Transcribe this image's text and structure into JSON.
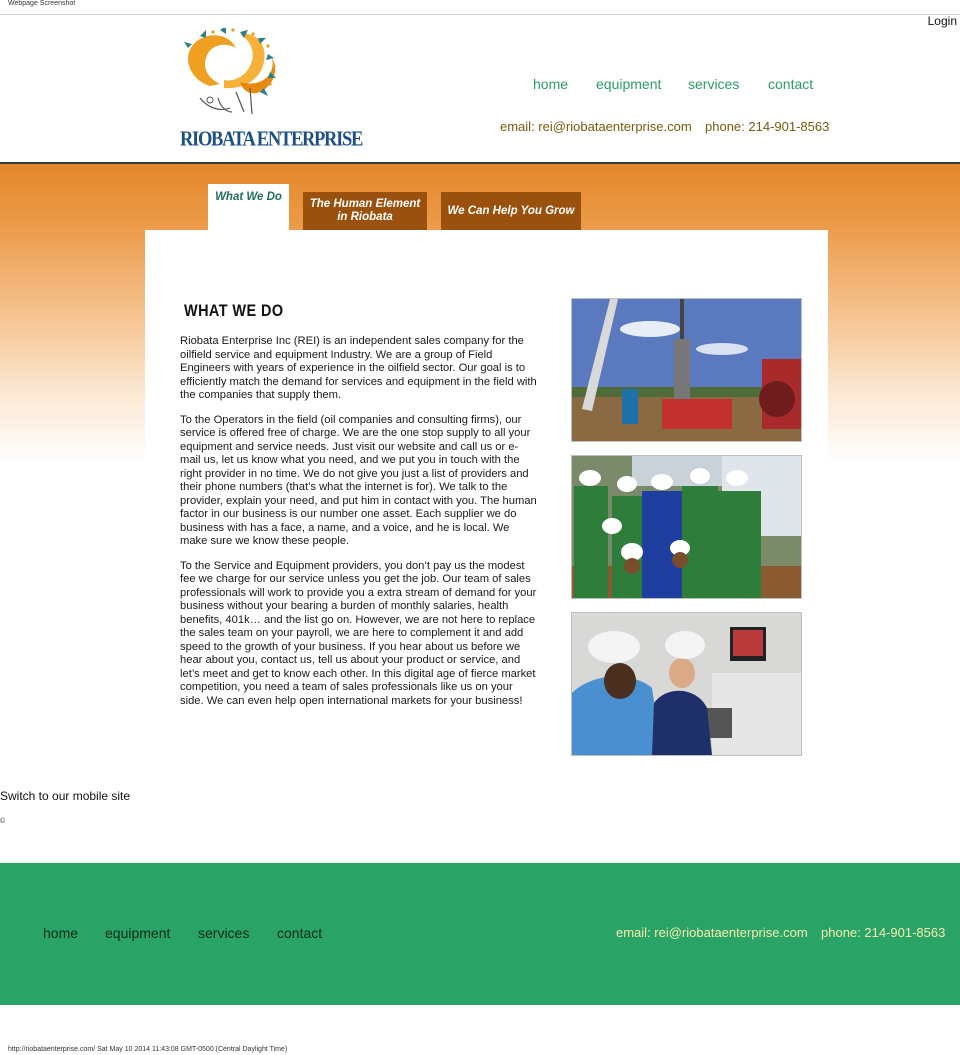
{
  "browser": {
    "caption": "Webpage Screenshot",
    "footer_caption": "http://riobataenterprise.com/ Sat May 10 2014 11:43:08 GMT-0500 (Central Daylight Time)"
  },
  "header": {
    "login": "Login",
    "logo_text": "RIOBATA ENTERPRISE",
    "nav": [
      "home",
      "equipment",
      "services",
      "contact"
    ],
    "email": "email: rei@riobataenterprise.com",
    "phone": "phone: 214-901-8563"
  },
  "tabs": [
    {
      "label": "What We Do",
      "active": true
    },
    {
      "label": "The Human Element in Riobata",
      "active": false
    },
    {
      "label": "We Can Help You Grow",
      "active": false
    }
  ],
  "main": {
    "heading": "WHAT WE DO",
    "paragraphs": [
      "Riobata Enterprise Inc (REI) is an independent sales company for the oilfield service and equipment Industry. We are a group of Field Engineers with years of experience in the oilfield sector. Our goal is to efficiently match the demand for services and equipment in the field with the companies that supply them.",
      "To the Operators in the field (oil companies and consulting firms), our service is offered free of charge. We are the one stop supply to all your equipment and service needs. Just visit our website and call us or e-mail us, let us know what you need, and we put you in touch with the right provider in no time. We do not give you just a list of providers and their phone numbers (that’s what the internet is for). We talk to the provider, explain your need, and put him in contact with you. The human factor in our business is our number one asset. Each supplier we do business with has a face, a name, and a voice, and he is local. We make sure we know these people.",
      "To the Service and Equipment providers, you don’t pay us the modest fee we charge for our service unless you get the job. Our team of sales professionals will work to provide you a extra stream of demand for your business without your bearing a burden of monthly salaries, health benefits, 401k… and the list go on. However, we are not here to replace the sales team on your payroll, we are here to complement it and add speed to the growth of your business. If you hear about us before we hear about you, contact us, tell us about your product or service, and let’s meet and get to know each other. In this digital age of fierce market competition, you need a team of sales professionals like us on your side. We can even help open international markets for your business!"
    ]
  },
  "mobile_link": "Switch to our mobile site",
  "tiny_mark": "©",
  "footer": {
    "nav": [
      "home",
      "equipment",
      "services",
      "contact"
    ],
    "email": "email: rei@riobataenterprise.com",
    "phone": "phone: 214-901-8563"
  },
  "colors": {
    "brand_green": "#2aa466",
    "nav_green": "#2c9a66",
    "brand_orange": "#e4872a",
    "tab_brown": "#9a510d",
    "logo_blue": "#1c4f87"
  }
}
